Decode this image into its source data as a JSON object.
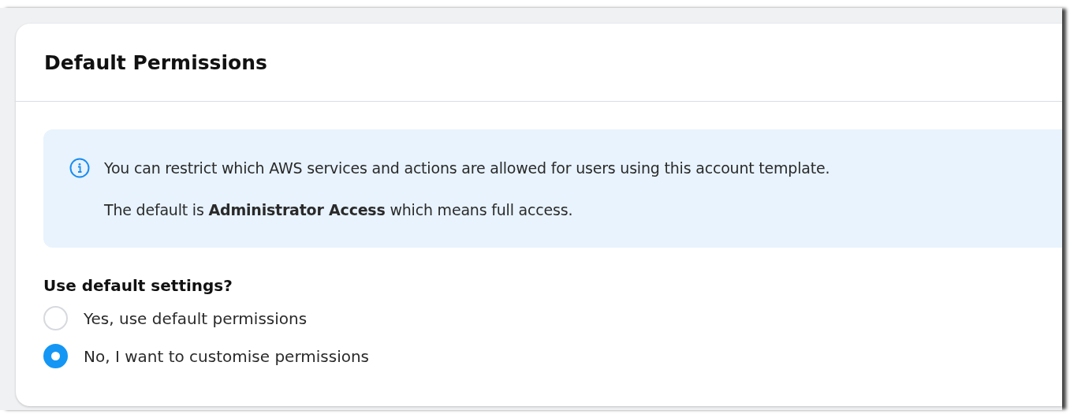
{
  "card": {
    "title": "Default Permissions"
  },
  "notice": {
    "lines": [
      "You can restrict which AWS services and actions are allowed for users using this account template.",
      "The default is **Administrator Access** which means full access."
    ]
  },
  "question": {
    "label": "Use default settings?",
    "options": [
      {
        "label": "Yes, use default permissions",
        "selected": false
      },
      {
        "label": "No, I want to customise permissions",
        "selected": true
      }
    ]
  }
}
